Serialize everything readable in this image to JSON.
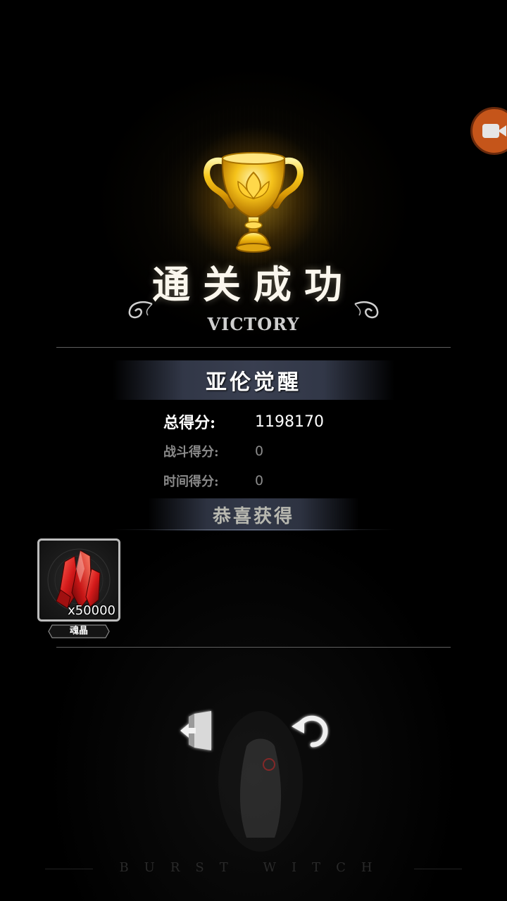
{
  "header": {
    "title_cn": "通关成功",
    "subtitle_en": "VICTORY"
  },
  "stage": {
    "name": "亚伦觉醒"
  },
  "scores": {
    "total_label": "总得分:",
    "total_value": "1198170",
    "battle_label": "战斗得分:",
    "battle_value": "0",
    "time_label": "时间得分:",
    "time_value": "0"
  },
  "rewards": {
    "title": "恭喜获得",
    "items": [
      {
        "name": "魂晶",
        "count": "x50000",
        "icon": "red-crystal-icon"
      }
    ]
  },
  "actions": {
    "exit_icon": "exit-door-icon",
    "retry_icon": "retry-arrow-icon",
    "record_icon": "video-camera-icon"
  },
  "footer": {
    "brand": "BURST WITCH"
  },
  "colors": {
    "background": "#000000",
    "record_button": "#c5551a",
    "trophy_gold": "#f2b80f",
    "crystal_red": "#d42020"
  }
}
